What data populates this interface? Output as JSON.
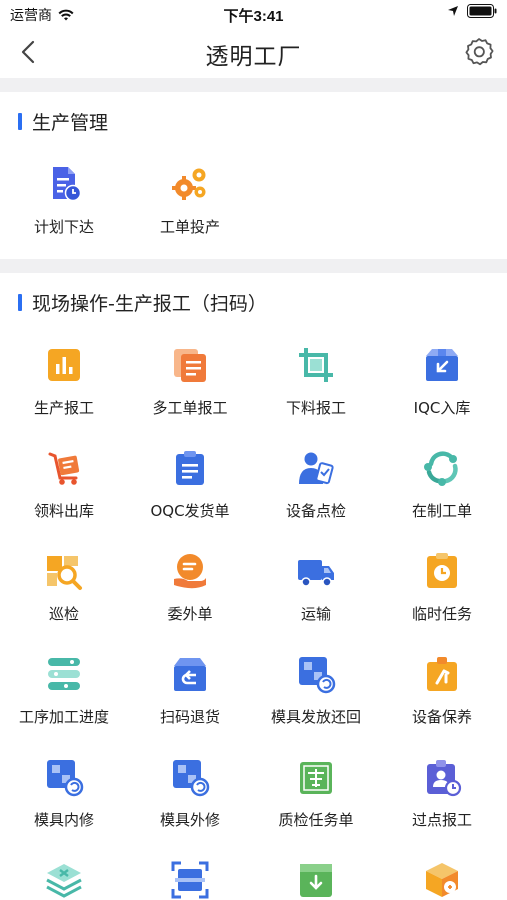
{
  "status_bar": {
    "carrier": "运营商",
    "time": "下午3:41"
  },
  "nav": {
    "title": "透明工厂"
  },
  "sections": [
    {
      "title": "生产管理",
      "items": [
        {
          "label": "计划下达",
          "icon": "plan-doc-icon"
        },
        {
          "label": "工单投产",
          "icon": "gears-icon"
        }
      ]
    },
    {
      "title": "现场操作-生产报工（扫码）",
      "items": [
        {
          "label": "生产报工",
          "icon": "bar-chart-icon"
        },
        {
          "label": "多工单报工",
          "icon": "multi-doc-icon"
        },
        {
          "label": "下料报工",
          "icon": "crop-icon"
        },
        {
          "label": "IQC入库",
          "icon": "inbound-box-icon"
        },
        {
          "label": "领料出库",
          "icon": "cart-icon"
        },
        {
          "label": "OQC发货单",
          "icon": "clipboard-icon"
        },
        {
          "label": "设备点检",
          "icon": "inspector-icon"
        },
        {
          "label": "在制工单",
          "icon": "cycle-icon"
        },
        {
          "label": "巡检",
          "icon": "search-doc-icon"
        },
        {
          "label": "委外单",
          "icon": "hand-coin-icon"
        },
        {
          "label": "运输",
          "icon": "truck-icon"
        },
        {
          "label": "临时任务",
          "icon": "clock-board-icon"
        },
        {
          "label": "工序加工进度",
          "icon": "progress-stack-icon"
        },
        {
          "label": "扫码退货",
          "icon": "return-box-icon"
        },
        {
          "label": "模具发放还回",
          "icon": "mold-refresh-icon"
        },
        {
          "label": "设备保养",
          "icon": "wrench-tag-icon"
        },
        {
          "label": "模具内修",
          "icon": "mold-inner-icon"
        },
        {
          "label": "模具外修",
          "icon": "mold-outer-icon"
        },
        {
          "label": "质检任务单",
          "icon": "quality-check-icon"
        },
        {
          "label": "过点报工",
          "icon": "user-clock-icon"
        },
        {
          "label": "",
          "icon": "layers-x-icon"
        },
        {
          "label": "",
          "icon": "scan-frame-icon"
        },
        {
          "label": "",
          "icon": "download-box-icon"
        },
        {
          "label": "",
          "icon": "package-icon"
        }
      ]
    }
  ],
  "colors": {
    "accent": "#2b6ff2",
    "orange": "#f5a623",
    "blue": "#3b6fe0",
    "teal": "#48b8a8",
    "green": "#5ab45a",
    "purple": "#5b5fd6"
  }
}
